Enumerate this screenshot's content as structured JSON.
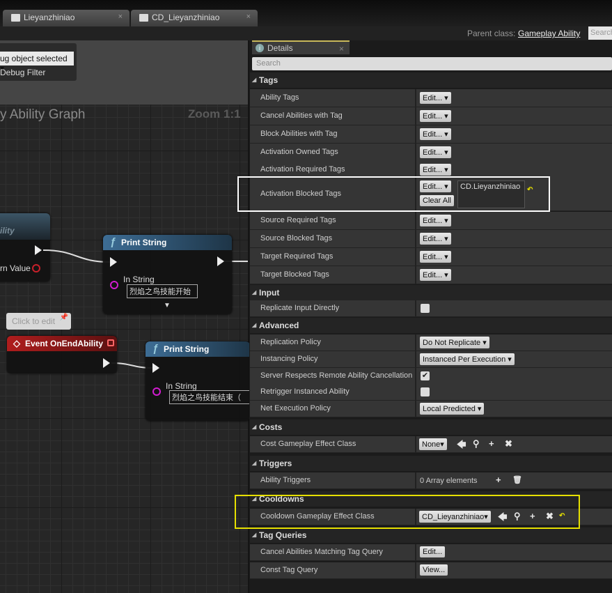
{
  "tabs": [
    {
      "label": "Lieyanzhiniao",
      "close": "×"
    },
    {
      "label": "CD_Lieyanzhiniao",
      "close": "×"
    }
  ],
  "parent_class": {
    "label": "Parent class:",
    "value": "Gameplay Ability",
    "search": "Search"
  },
  "graph": {
    "debug_select": "ug object selected",
    "debug_filter": "Debug Filter",
    "title": "y Ability Graph",
    "zoom": "Zoom 1:1",
    "node_activate": {
      "title": "ility",
      "return_value": "rn Value"
    },
    "print1": {
      "title": "Print String",
      "pin": "In String",
      "value": "烈焰之鸟技能开始"
    },
    "comment": "Click to edit",
    "event_end": {
      "title": "Event OnEndAbility"
    },
    "print2": {
      "title": "Print String",
      "pin": "In String",
      "value": "烈焰之鸟技能结束（"
    }
  },
  "details": {
    "tab": "Details",
    "tab_close": "×",
    "search_placeholder": "Search",
    "accent_colors": {
      "activation_highlight": "#ffffff",
      "cooldown_highlight": "#e6e000"
    },
    "sections": [
      {
        "header": "Tags",
        "rows": [
          {
            "label": "Ability Tags",
            "value": "Edit...",
            "type": "edit"
          },
          {
            "label": "Cancel Abilities with Tag",
            "value": "Edit...",
            "type": "edit"
          },
          {
            "label": "Block Abilities with Tag",
            "value": "Edit...",
            "type": "edit"
          },
          {
            "label": "Activation Owned Tags",
            "value": "Edit...",
            "type": "edit"
          },
          {
            "label": "Activation Required Tags",
            "value": "Edit...",
            "type": "edit"
          },
          {
            "label": "Activation Blocked Tags",
            "value": "Edit...",
            "type": "edittag",
            "clear": "Clear All",
            "tag": "CD.Lieyanzhiniao"
          },
          {
            "label": "Source Required Tags",
            "value": "Edit...",
            "type": "edit"
          },
          {
            "label": "Source Blocked Tags",
            "value": "Edit...",
            "type": "edit"
          },
          {
            "label": "Target Required Tags",
            "value": "Edit...",
            "type": "edit"
          },
          {
            "label": "Target Blocked Tags",
            "value": "Edit...",
            "type": "edit"
          }
        ]
      },
      {
        "header": "Input",
        "rows": [
          {
            "label": "Replicate Input Directly",
            "type": "check",
            "checked": false
          }
        ]
      },
      {
        "header": "Advanced",
        "rows": [
          {
            "label": "Replication Policy",
            "value": "Do Not Replicate",
            "type": "combo"
          },
          {
            "label": "Instancing Policy",
            "value": "Instanced Per Execution",
            "type": "combo"
          },
          {
            "label": "Server Respects Remote Ability Cancellation",
            "type": "check",
            "checked": true
          },
          {
            "label": "Retrigger Instanced Ability",
            "type": "check",
            "checked": false
          },
          {
            "label": "Net Execution Policy",
            "value": "Local Predicted",
            "type": "combo"
          }
        ]
      },
      {
        "header": "Costs",
        "rows": [
          {
            "label": "Cost Gameplay Effect Class",
            "value": "None",
            "type": "class"
          }
        ]
      },
      {
        "header": "Triggers",
        "rows": [
          {
            "label": "Ability Triggers",
            "value": "0 Array elements",
            "type": "array"
          }
        ]
      },
      {
        "header": "Cooldowns",
        "rows": [
          {
            "label": "Cooldown Gameplay Effect Class",
            "value": "CD_Lieyanzhiniao",
            "type": "class",
            "reset": true
          }
        ]
      },
      {
        "header": "Tag Queries",
        "rows": [
          {
            "label": "Cancel Abilities Matching Tag Query",
            "value": "Edit...",
            "type": "button"
          },
          {
            "label": "Const Tag Query",
            "value": "View...",
            "type": "button"
          }
        ]
      }
    ]
  }
}
